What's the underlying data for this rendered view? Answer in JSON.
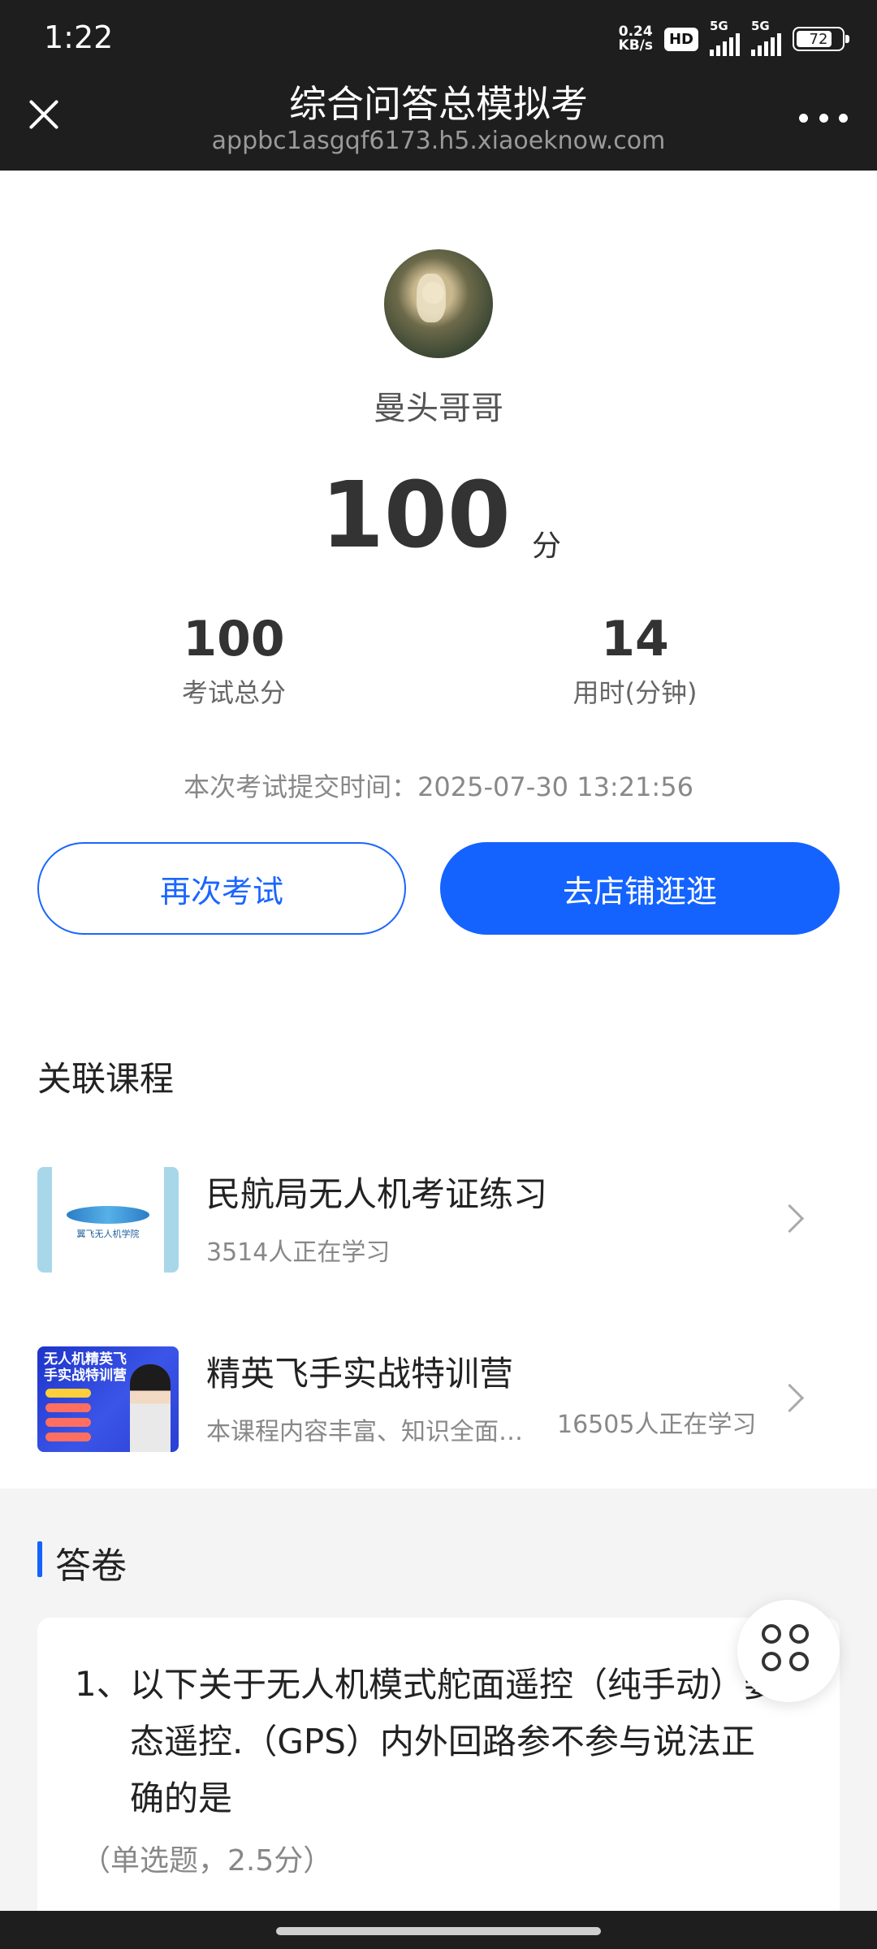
{
  "status_bar": {
    "time": "1:22",
    "net_speed_value": "0.24",
    "net_speed_unit": "KB/s",
    "hd_label": "HD",
    "signal1_label": "5G",
    "signal2_label": "5G",
    "battery_level": "72"
  },
  "header": {
    "title": "综合问答总模拟考",
    "url": "appbc1asgqf6173.h5.xiaoeknow.com",
    "close_icon": "close-icon",
    "more_icon": "more-icon"
  },
  "result": {
    "username": "曼头哥哥",
    "score": "100",
    "score_unit": "分",
    "total_score_value": "100",
    "total_score_label": "考试总分",
    "time_used_value": "14",
    "time_used_label": "用时(分钟)",
    "submit_time": "本次考试提交时间：2025-07-30 13:21:56",
    "retry_button": "再次考试",
    "shop_button": "去店铺逛逛"
  },
  "related": {
    "section_title": "关联课程",
    "courses": [
      {
        "name": "民航局无人机考证练习",
        "learners": "3514人正在学习",
        "thumb_caption": "翼飞无人机学院"
      },
      {
        "name": "精英飞手实战特训营",
        "description": "本课程内容丰富、知识全面…",
        "learners": "16505人正在学习",
        "thumb_caption": "无人机精英飞手实战特训营"
      }
    ]
  },
  "answer_sheet": {
    "title": "答卷",
    "question_number": "1、",
    "question_text": "以下关于无人机模式舵面遥控（纯手动）姿态遥控.（GPS）内外回路参不参与说法正确的是",
    "question_type": "（单选题，2.5分）"
  },
  "colors": {
    "primary": "#1463ff",
    "header_bg": "#1e1e1e",
    "section_bg": "#f4f4f4"
  }
}
